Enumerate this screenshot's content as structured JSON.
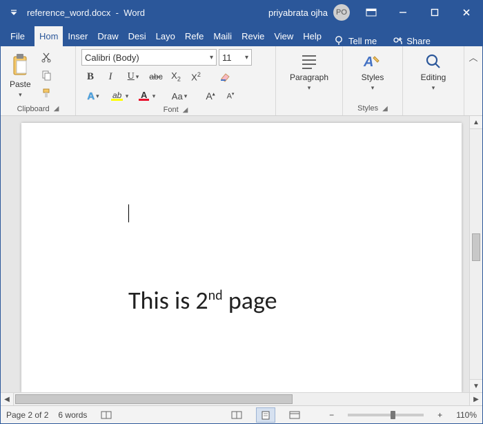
{
  "title": {
    "doc": "reference_word.docx",
    "app": "Word",
    "user": "priyabrata ojha",
    "initials": "PO"
  },
  "tabs": [
    "File",
    "Hom",
    "Inser",
    "Draw",
    "Desi",
    "Layo",
    "Refe",
    "Maili",
    "Revie",
    "View",
    "Help"
  ],
  "tellme": "Tell me",
  "share": "Share",
  "ribbon": {
    "clipboard": {
      "label": "Clipboard",
      "paste": "Paste"
    },
    "font": {
      "label": "Font",
      "name": "Calibri (Body)",
      "size": "11"
    },
    "paragraph": {
      "label": "Paragraph"
    },
    "styles": {
      "label": "Styles",
      "button": "Styles"
    },
    "editing": {
      "label": "Editing"
    }
  },
  "doc": {
    "text_before": "This is 2",
    "text_sup": "nd",
    "text_after": "page"
  },
  "status": {
    "page": "Page 2 of 2",
    "words": "6 words",
    "zoom": "110%"
  }
}
